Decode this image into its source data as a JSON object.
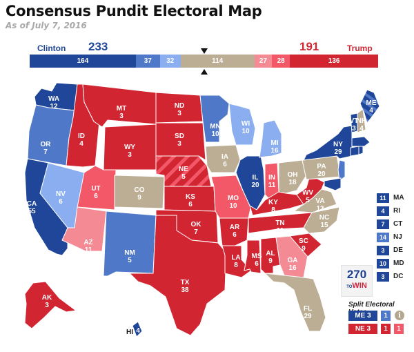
{
  "header": {
    "title": "Consensus Pundit Electoral Map",
    "subtitle": "As of July 7, 2016"
  },
  "colors": {
    "safe_dem": "#1f4699",
    "likely_dem": "#5078c8",
    "lean_dem": "#8aaef0",
    "tossup": "#bcae95",
    "lean_rep": "#f48a94",
    "likely_rep": "#f35868",
    "safe_rep": "#d22532"
  },
  "tally": {
    "dem": {
      "name": "Clinton",
      "total": "233"
    },
    "rep": {
      "name": "Trump",
      "total": "191"
    },
    "segments": [
      {
        "category": "safe_dem",
        "value": 164,
        "label": "164"
      },
      {
        "category": "likely_dem",
        "value": 37,
        "label": "37"
      },
      {
        "category": "lean_dem",
        "value": 32,
        "label": "32"
      },
      {
        "category": "tossup",
        "value": 114,
        "label": "114"
      },
      {
        "category": "lean_rep",
        "value": 27,
        "label": "27"
      },
      {
        "category": "likely_rep",
        "value": 28,
        "label": "28"
      },
      {
        "category": "safe_rep",
        "value": 136,
        "label": "136"
      }
    ]
  },
  "states": [
    {
      "abbr": "WA",
      "ev": "12",
      "category": "safe_dem"
    },
    {
      "abbr": "OR",
      "ev": "7",
      "category": "likely_dem"
    },
    {
      "abbr": "CA",
      "ev": "55",
      "category": "safe_dem"
    },
    {
      "abbr": "NV",
      "ev": "6",
      "category": "lean_dem"
    },
    {
      "abbr": "ID",
      "ev": "4",
      "category": "safe_rep"
    },
    {
      "abbr": "MT",
      "ev": "3",
      "category": "safe_rep"
    },
    {
      "abbr": "WY",
      "ev": "3",
      "category": "safe_rep"
    },
    {
      "abbr": "UT",
      "ev": "6",
      "category": "likely_rep"
    },
    {
      "abbr": "AZ",
      "ev": "11",
      "category": "lean_rep"
    },
    {
      "abbr": "CO",
      "ev": "9",
      "category": "tossup"
    },
    {
      "abbr": "NM",
      "ev": "5",
      "category": "likely_dem"
    },
    {
      "abbr": "ND",
      "ev": "3",
      "category": "safe_rep"
    },
    {
      "abbr": "SD",
      "ev": "3",
      "category": "safe_rep"
    },
    {
      "abbr": "NE",
      "ev": "5",
      "category": "safe_rep"
    },
    {
      "abbr": "KS",
      "ev": "6",
      "category": "safe_rep"
    },
    {
      "abbr": "OK",
      "ev": "7",
      "category": "safe_rep"
    },
    {
      "abbr": "TX",
      "ev": "38",
      "category": "safe_rep"
    },
    {
      "abbr": "MN",
      "ev": "10",
      "category": "likely_dem"
    },
    {
      "abbr": "IA",
      "ev": "6",
      "category": "tossup"
    },
    {
      "abbr": "MO",
      "ev": "10",
      "category": "likely_rep"
    },
    {
      "abbr": "AR",
      "ev": "6",
      "category": "safe_rep"
    },
    {
      "abbr": "LA",
      "ev": "8",
      "category": "safe_rep"
    },
    {
      "abbr": "WI",
      "ev": "10",
      "category": "lean_dem"
    },
    {
      "abbr": "IL",
      "ev": "20",
      "category": "safe_dem"
    },
    {
      "abbr": "MI",
      "ev": "16",
      "category": "lean_dem"
    },
    {
      "abbr": "IN",
      "ev": "11",
      "category": "likely_rep"
    },
    {
      "abbr": "OH",
      "ev": "18",
      "category": "tossup"
    },
    {
      "abbr": "KY",
      "ev": "8",
      "category": "safe_rep"
    },
    {
      "abbr": "TN",
      "ev": "11",
      "category": "safe_rep"
    },
    {
      "abbr": "MS",
      "ev": "6",
      "category": "safe_rep"
    },
    {
      "abbr": "AL",
      "ev": "9",
      "category": "safe_rep"
    },
    {
      "abbr": "GA",
      "ev": "16",
      "category": "lean_rep"
    },
    {
      "abbr": "FL",
      "ev": "29",
      "category": "tossup"
    },
    {
      "abbr": "SC",
      "ev": "9",
      "category": "safe_rep"
    },
    {
      "abbr": "NC",
      "ev": "15",
      "category": "tossup"
    },
    {
      "abbr": "VA",
      "ev": "13",
      "category": "tossup"
    },
    {
      "abbr": "WV",
      "ev": "5",
      "category": "safe_rep"
    },
    {
      "abbr": "PA",
      "ev": "20",
      "category": "tossup"
    },
    {
      "abbr": "NY",
      "ev": "29",
      "category": "safe_dem"
    },
    {
      "abbr": "VT",
      "ev": "3",
      "category": "safe_dem"
    },
    {
      "abbr": "NH",
      "ev": "4",
      "category": "tossup"
    },
    {
      "abbr": "ME",
      "ev": "4",
      "category": "safe_dem"
    },
    {
      "abbr": "AK",
      "ev": "3",
      "category": "safe_rep"
    },
    {
      "abbr": "HI",
      "ev": "4",
      "category": "safe_dem"
    }
  ],
  "small_states": [
    {
      "abbr": "MA",
      "ev": "11",
      "category": "safe_dem"
    },
    {
      "abbr": "RI",
      "ev": "4",
      "category": "safe_dem"
    },
    {
      "abbr": "CT",
      "ev": "7",
      "category": "safe_dem"
    },
    {
      "abbr": "NJ",
      "ev": "14",
      "category": "likely_dem"
    },
    {
      "abbr": "DE",
      "ev": "3",
      "category": "safe_dem"
    },
    {
      "abbr": "MD",
      "ev": "10",
      "category": "safe_dem"
    },
    {
      "abbr": "DC",
      "ev": "3",
      "category": "safe_dem"
    }
  ],
  "logo": {
    "number": "270",
    "to": "TO",
    "win": "WIN"
  },
  "split_votes": {
    "title": "Split Electoral Votes",
    "rows": [
      {
        "label": "ME 3",
        "category": "safe_dem",
        "districts": [
          {
            "value": "1",
            "category": "likely_dem"
          }
        ]
      },
      {
        "label": "NE 3",
        "category": "safe_rep",
        "districts": [
          {
            "value": "1",
            "category": "safe_rep"
          },
          {
            "value": "1",
            "category": "likely_rep"
          }
        ]
      }
    ],
    "info_icon": "i"
  }
}
